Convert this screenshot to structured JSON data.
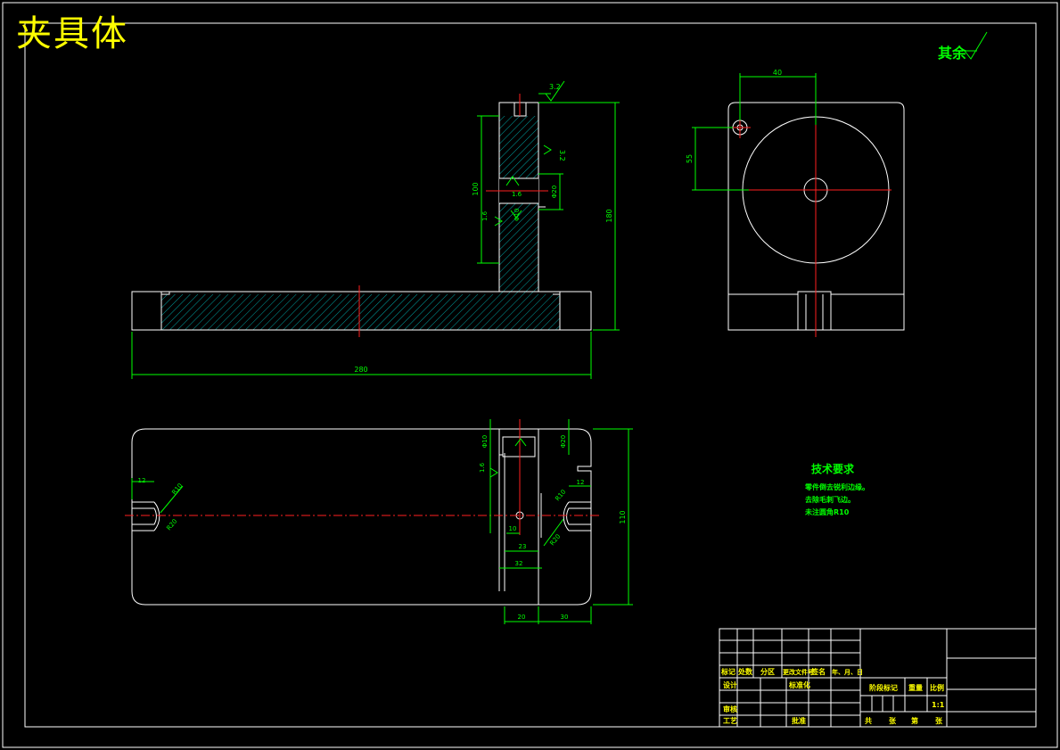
{
  "title": "夹具体",
  "surface_finish_rest": "其余",
  "roughness": {
    "top": "3.2",
    "slot": "3.2",
    "face": "1.6",
    "hole": "1.6",
    "ref": "1.6",
    "plan_side": "1.6"
  },
  "dims": {
    "base_length": "280",
    "total_height": "180",
    "upright_height": "100",
    "hole_offset_h": "40",
    "hole_offset_v": "55",
    "hole_dia": "Φ20",
    "hole_dia2": "Φ10",
    "plan_width": "110",
    "slot_l": "12",
    "slot_r": "12",
    "r_left": "R10",
    "r_left2": "R20",
    "r_right": "R10",
    "r_right2": "R20",
    "d10": "10",
    "d23": "23",
    "d32": "32",
    "d20": "20",
    "d30": "30",
    "plan_top1": "Φ10",
    "plan_top2": "Φ20"
  },
  "tech_requirements": {
    "heading": "技术要求",
    "lines": [
      "零件倒去锐利边缘。",
      "去除毛刺飞边。",
      "未注圆角R10"
    ]
  },
  "title_block": {
    "r_mark": "标记",
    "r_count": "处数",
    "r_zone": "分区",
    "r_docno": "更改文件号",
    "r_sign": "签名",
    "r_date": "年、月、日",
    "design": "设计",
    "standard": "标准化",
    "review": "审核",
    "process": "工艺",
    "approve": "批准",
    "stage": "阶段标记",
    "weight": "重量",
    "scale": "比例",
    "scale_val": "1:1",
    "sheets": "共",
    "sheet_of": "张",
    "sheet_no": "第",
    "sheet_of2": "张"
  }
}
